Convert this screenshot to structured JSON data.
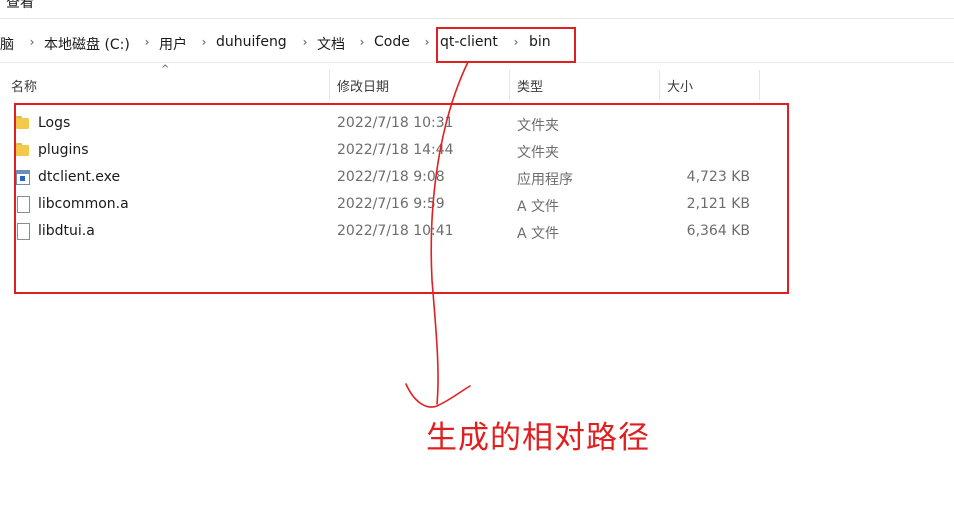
{
  "topbar": {
    "label": "查看"
  },
  "breadcrumb": {
    "items": [
      "电脑",
      "本地磁盘 (C:)",
      "用户",
      "duhuifeng",
      "文档",
      "Code",
      "qt-client",
      "bin"
    ]
  },
  "columns": {
    "name": "名称",
    "date": "修改日期",
    "type": "类型",
    "size": "大小"
  },
  "files": [
    {
      "name": "Logs",
      "date": "2022/7/18 10:31",
      "type": "文件夹",
      "size": "",
      "icon": "folder-icon"
    },
    {
      "name": "plugins",
      "date": "2022/7/18 14:44",
      "type": "文件夹",
      "size": "",
      "icon": "folder-icon"
    },
    {
      "name": "dtclient.exe",
      "date": "2022/7/18 9:08",
      "type": "应用程序",
      "size": "4,723 KB",
      "icon": "exe-icon"
    },
    {
      "name": "libcommon.a",
      "date": "2022/7/16 9:59",
      "type": "A 文件",
      "size": "2,121 KB",
      "icon": "file-icon"
    },
    {
      "name": "libdtui.a",
      "date": "2022/7/18 10:41",
      "type": "A 文件",
      "size": "6,364 KB",
      "icon": "file-icon"
    }
  ],
  "annotation": {
    "text": "生成的相对路径",
    "color": "#e02020"
  }
}
